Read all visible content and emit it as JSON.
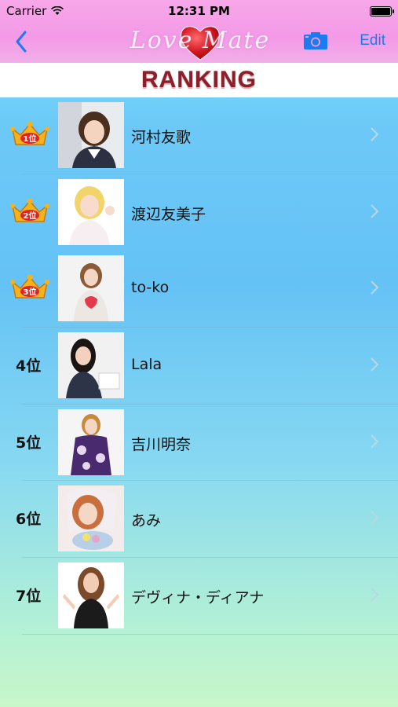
{
  "status": {
    "carrier": "Carrier",
    "time": "12:31 PM"
  },
  "nav": {
    "logo_text": "Love Mate",
    "edit_label": "Edit"
  },
  "title": "RANKING",
  "colors": {
    "accent": "#1a7cf0",
    "header_pink": "#f49ae7",
    "title_red": "#8c1f2b",
    "crown_gold": "#f6b21b"
  },
  "rows": [
    {
      "rank": "1位",
      "name": "河村友歌",
      "crown": true
    },
    {
      "rank": "2位",
      "name": "渡辺友美子",
      "crown": true
    },
    {
      "rank": "3位",
      "name": "to-ko",
      "crown": true
    },
    {
      "rank": "4位",
      "name": "Lala",
      "crown": false
    },
    {
      "rank": "5位",
      "name": "吉川明奈",
      "crown": false
    },
    {
      "rank": "6位",
      "name": "あみ",
      "crown": false
    },
    {
      "rank": "7位",
      "name": "デヴィナ・ディアナ",
      "crown": false
    }
  ]
}
